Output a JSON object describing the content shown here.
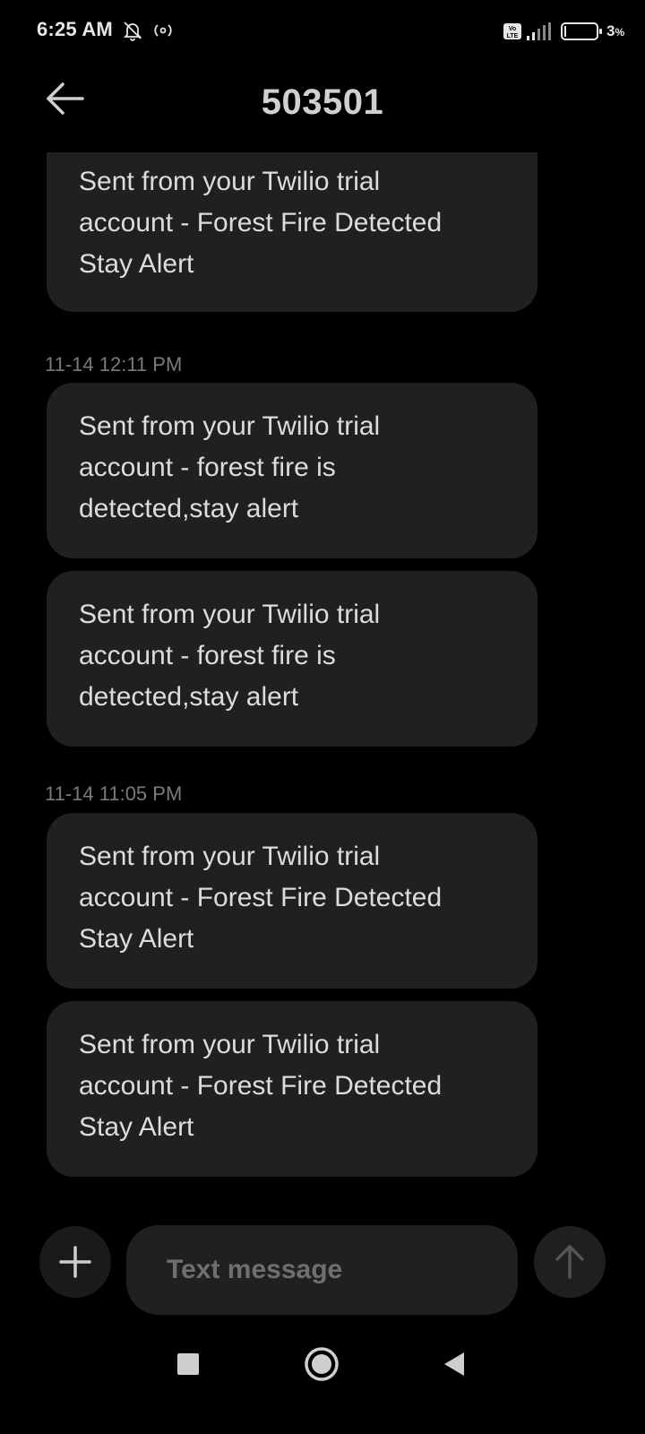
{
  "status_bar": {
    "time": "6:25 AM",
    "battery_percent": "3",
    "battery_symbol": "%",
    "icons": [
      "bell-muted-icon",
      "hotspot-icon",
      "volte-icon",
      "signal-icon",
      "battery-icon"
    ]
  },
  "header": {
    "title": "503501",
    "back_icon": "arrow-left-icon"
  },
  "messages": {
    "m0": "Sent from your Twilio trial\naccount - Forest Fire Detected\nStay Alert",
    "ts1": "11-14 12:11 PM",
    "m1": "Sent from your Twilio trial\naccount - forest fire is\ndetected,stay alert",
    "m2": "Sent from your Twilio trial\naccount - forest fire is\ndetected,stay alert",
    "ts2": "11-14 11:05 PM",
    "m3": "Sent from your Twilio trial\naccount - Forest Fire Detected\nStay Alert",
    "m4": "Sent from your Twilio trial\naccount - Forest Fire Detected\nStay Alert"
  },
  "composer": {
    "placeholder": "Text message",
    "value": "",
    "attach_icon": "plus-icon",
    "send_icon": "arrow-up-icon"
  },
  "nav_bar": {
    "icons": [
      "square-recents-icon",
      "circle-home-icon",
      "triangle-back-icon"
    ]
  },
  "colors": {
    "background": "#000000",
    "bubble": "#202020",
    "text": "#dcdcdc",
    "timestamp": "#7a7a7a"
  }
}
